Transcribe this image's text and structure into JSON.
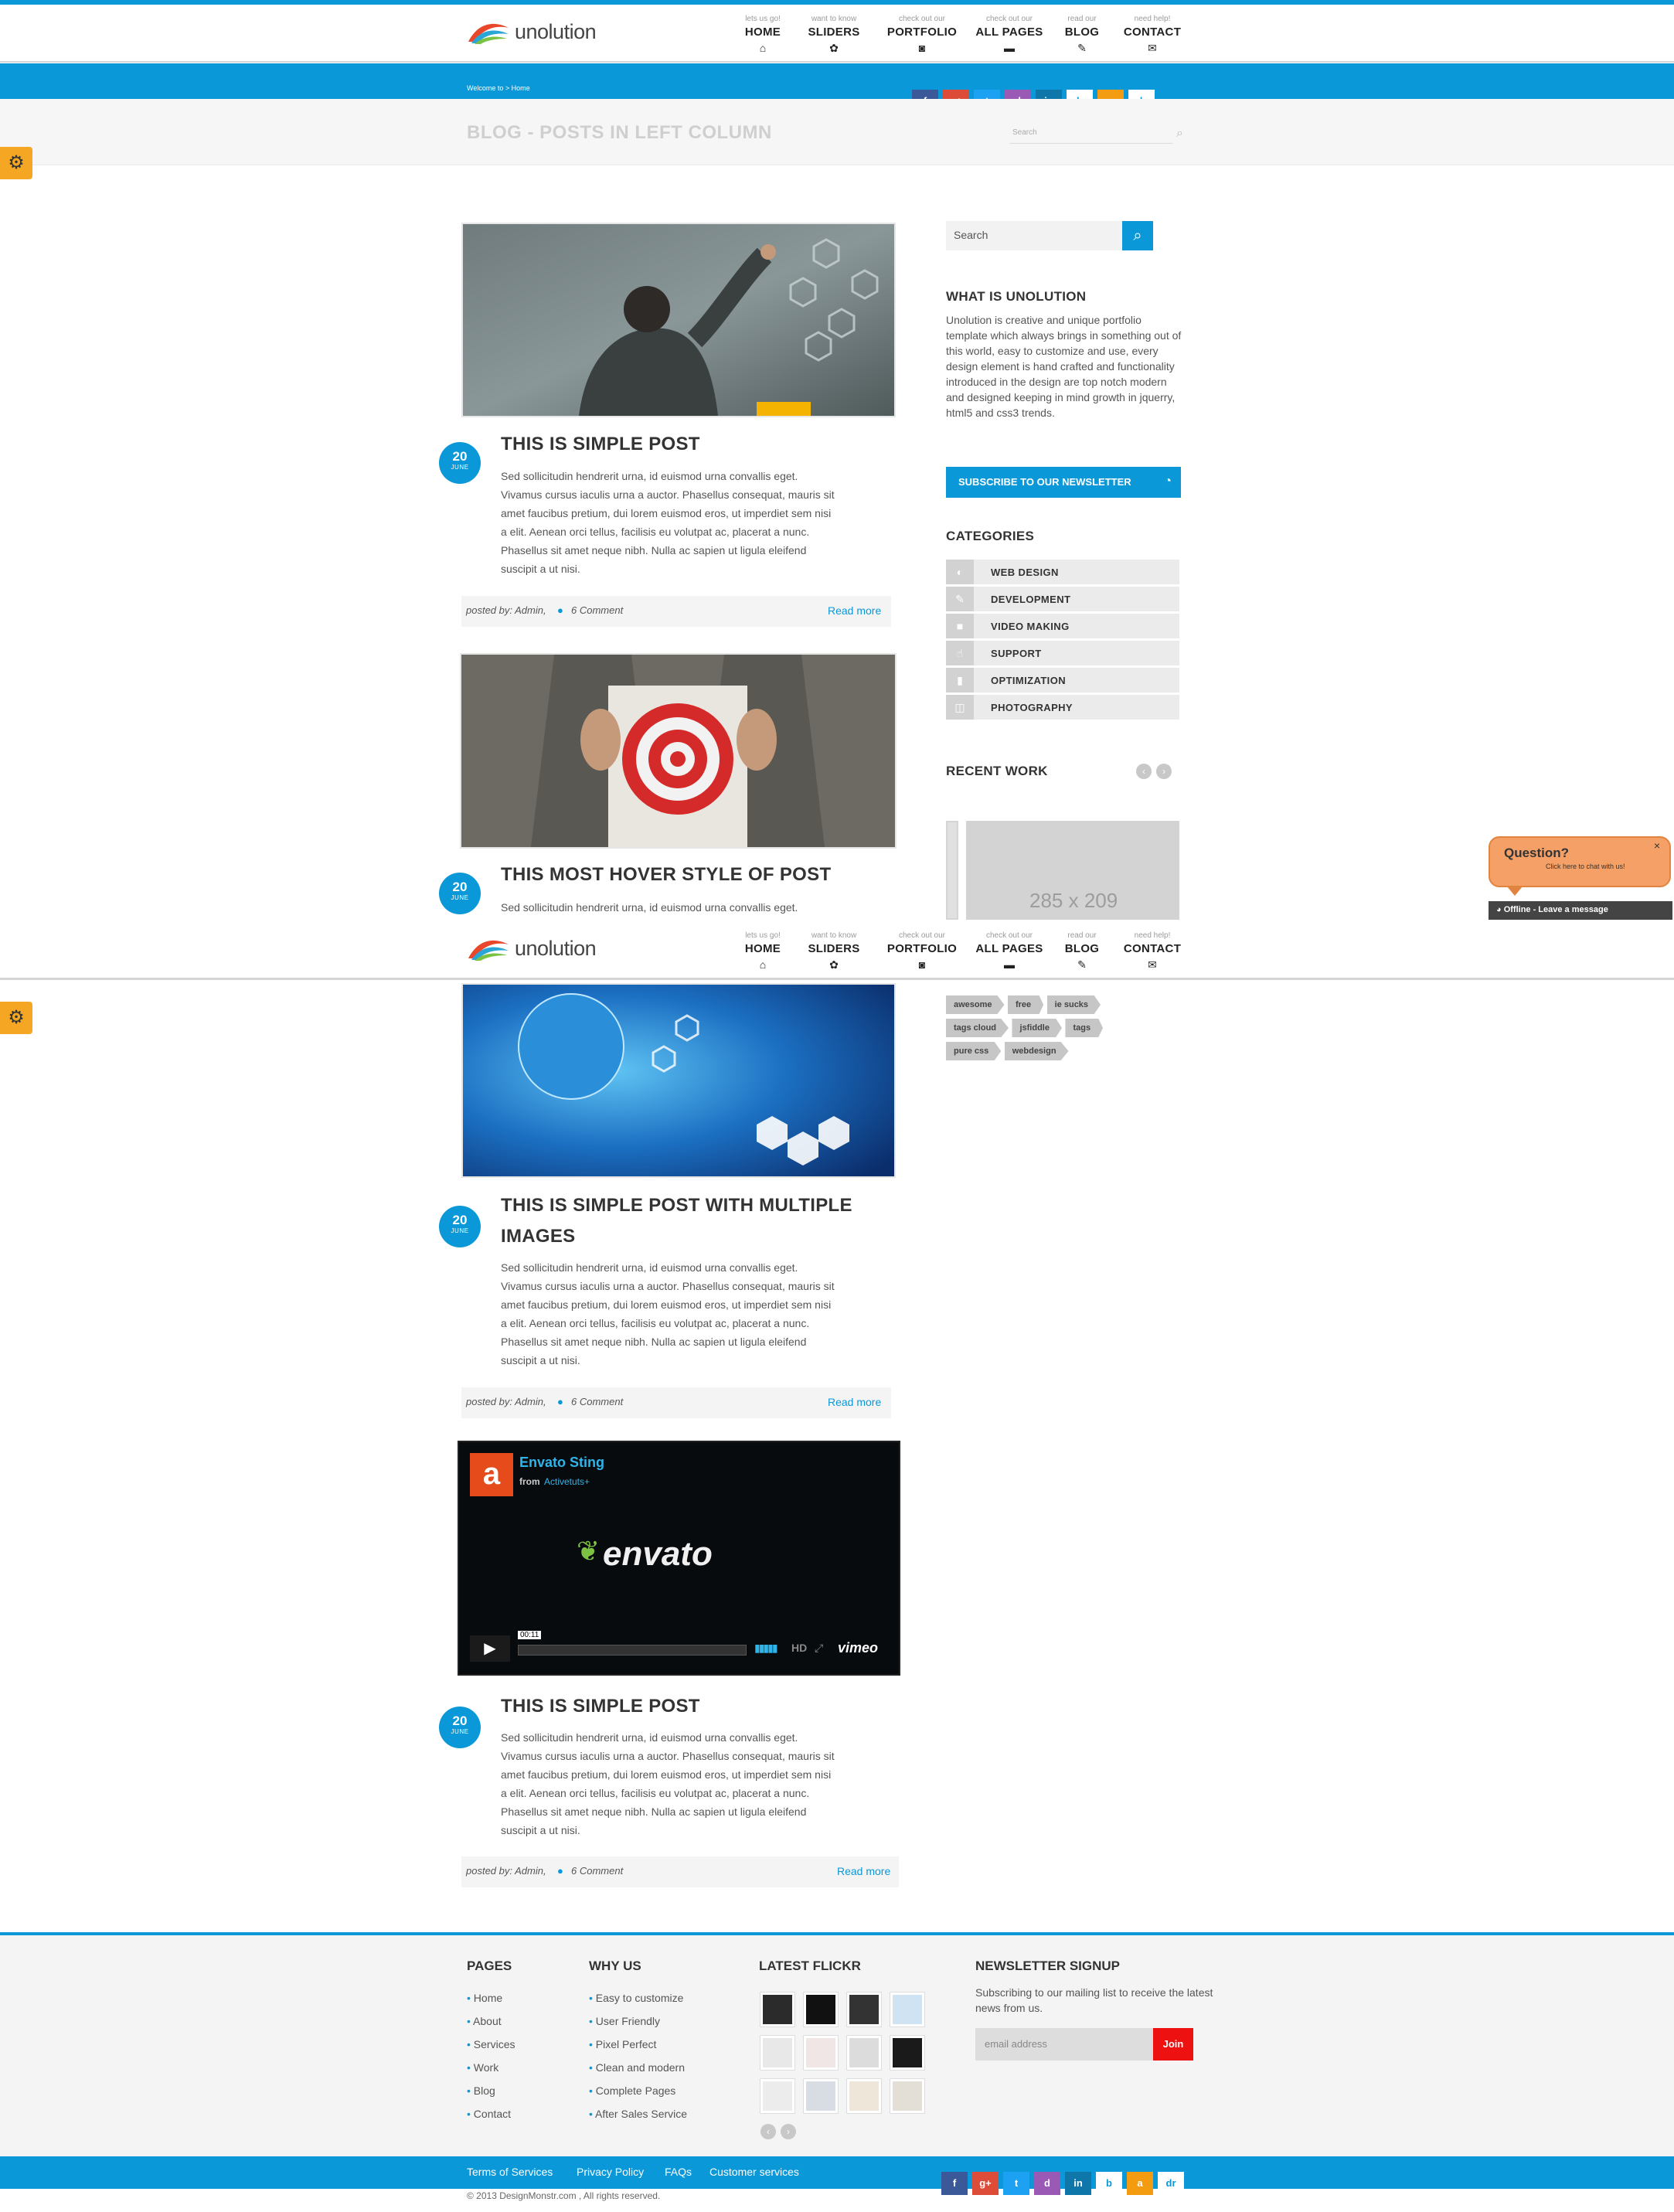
{
  "header": {
    "logo_text": "unolution",
    "nav": [
      {
        "sub": "lets us go!",
        "label": "HOME",
        "icon": "⌂"
      },
      {
        "sub": "want to know",
        "label": "SLIDERS",
        "icon": "✿"
      },
      {
        "sub": "check out our",
        "label": "PORTFOLIO",
        "icon": "◙"
      },
      {
        "sub": "check out our",
        "label": "ALL PAGES",
        "icon": "▬"
      },
      {
        "sub": "read our",
        "label": "BLOG",
        "icon": "✎"
      },
      {
        "sub": "need help!",
        "label": "CONTACT",
        "icon": "✉"
      }
    ]
  },
  "breadcrumb": "Welcome to > Home",
  "page_title": "BLOG - POSTS IN LEFT COLUMN",
  "header_search_placeholder": "Search",
  "social_icons": [
    "f",
    "g+",
    "t",
    "d",
    "in",
    "b",
    "a",
    "dr"
  ],
  "social_colors": [
    "#3b5998",
    "#dd4b39",
    "#1da1f2",
    "#9b59b6",
    "#0e76a8",
    "#ffffff",
    "#f39c12",
    "#ffffff"
  ],
  "posts": [
    {
      "date_day": "20",
      "date_month": "JUNE",
      "title": "THIS IS SIMPLE POST",
      "body": "Sed sollicitudin hendrerit urna, id euismod urna convallis eget. Vivamus cursus iaculis urna a auctor. Phasellus consequat, mauris sit amet faucibus pretium, dui lorem euismod eros, ut imperdiet sem nisi a elit. Aenean orci tellus, facilisis eu volutpat ac, placerat a nunc. Phasellus sit amet neque nibh. Nulla ac sapien ut ligula eleifend suscipit a ut nisi.",
      "meta_prefix": "posted by: Admin,",
      "comments": "6 Comment",
      "read_more": "Read more"
    },
    {
      "date_day": "20",
      "date_month": "JUNE",
      "title": "THIS MOST HOVER STYLE OF POST",
      "body": "Sed sollicitudin hendrerit urna, id euismod urna convallis eget."
    },
    {
      "date_day": "20",
      "date_month": "JUNE",
      "title": "THIS IS SIMPLE POST WITH MULTIPLE IMAGES",
      "body": "Sed sollicitudin hendrerit urna, id euismod urna convallis eget. Vivamus cursus iaculis urna a auctor. Phasellus consequat, mauris sit amet faucibus pretium, dui lorem euismod eros, ut imperdiet sem nisi a elit. Aenean orci tellus, facilisis eu volutpat ac, placerat a nunc. Phasellus sit amet neque nibh. Nulla ac sapien ut ligula eleifend suscipit a ut nisi.",
      "meta_prefix": "posted by: Admin,",
      "comments": "6 Comment",
      "read_more": "Read more"
    },
    {
      "date_day": "20",
      "date_month": "JUNE",
      "title": "THIS IS SIMPLE POST",
      "body": "Sed sollicitudin hendrerit urna, id euismod urna convallis eget. Vivamus cursus iaculis urna a auctor. Phasellus consequat, mauris sit amet faucibus pretium, dui lorem euismod eros, ut imperdiet sem nisi a elit. Aenean orci tellus, facilisis eu volutpat ac, placerat a nunc. Phasellus sit amet neque nibh. Nulla ac sapien ut ligula eleifend suscipit a ut nisi.",
      "meta_prefix": "posted by: Admin,",
      "comments": "6 Comment",
      "read_more": "Read more"
    }
  ],
  "video": {
    "channel": "Envato Sting",
    "from": "from",
    "author": "Activetuts+",
    "brand": "envato",
    "time": "00:11",
    "hd": "HD",
    "vimeo": "vimeo"
  },
  "sidebar": {
    "search_placeholder": "Search",
    "about_title": "WHAT IS UNOLUTION",
    "about_text": "Unolution is creative and unique portfolio template which always brings in something out of this world, easy to customize and use, every design element is hand crafted and functionality introduced in the design are top notch modern and designed keeping in mind growth in jquerry, html5 and css3 trends.",
    "subscribe_label": "SUBSCRIBE TO OUR NEWSLETTER",
    "categories_title": "CATEGORIES",
    "categories": [
      {
        "label": "WEB DESIGN",
        "icon": "◐"
      },
      {
        "label": "DEVELOPMENT",
        "icon": "✎"
      },
      {
        "label": "VIDEO MAKING",
        "icon": "■"
      },
      {
        "label": "SUPPORT",
        "icon": "☝"
      },
      {
        "label": "OPTIMIZATION",
        "icon": "▮"
      },
      {
        "label": "PHOTOGRAPHY",
        "icon": "◫"
      }
    ],
    "recent_work_title": "RECENT WORK",
    "recent_work_placeholder": "285 x 209",
    "tags": [
      "awesome",
      "free",
      "ie sucks",
      "tags cloud",
      "jsfiddle",
      "tags",
      "pure css",
      "webdesign"
    ]
  },
  "chat": {
    "title": "Question?",
    "sub": "Click here to chat with us!",
    "status": "Offline - Leave a message",
    "close": "×"
  },
  "footer": {
    "pages_title": "PAGES",
    "pages": [
      "Home",
      "About",
      "Services",
      "Work",
      "Blog",
      "Contact"
    ],
    "why_title": "WHY US",
    "why": [
      "Easy to customize",
      "User Friendly",
      "Pixel Perfect",
      "Clean and modern",
      "Complete Pages",
      "After Sales Service"
    ],
    "flickr_title": "LATEST FLICKR",
    "newsletter_title": "NEWSLETTER SIGNUP",
    "newsletter_text": "Subscribing to our mailing list to receive the latest news from us.",
    "email_placeholder": "email address",
    "join_label": "Join",
    "bottom_links": [
      "Terms of Services",
      "Privacy Policy",
      "FAQs",
      "Customer services"
    ],
    "copyright": "© 2013 DesignMonstr.com , All rights reserved."
  }
}
